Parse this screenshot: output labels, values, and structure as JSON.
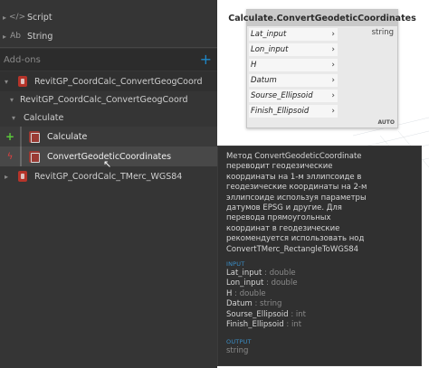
{
  "library": {
    "items": [
      {
        "label": "Script",
        "icon": "script-icon",
        "glyph": "</>"
      },
      {
        "label": "String",
        "icon": "string-icon",
        "glyph": "Ab"
      }
    ],
    "addons_label": "Add-ons",
    "add_button": "+",
    "tree": {
      "package": "RevitGP_CoordCalc_ConvertGeogCoord",
      "sub_package": "RevitGP_CoordCalc_ConvertGeogCoord",
      "category": "Calculate",
      "create_node": "Calculate",
      "action_node": "ConvertGeodeticCoordinates",
      "other_package": "RevitGP_CoordCalc_TMerc_WGS84"
    }
  },
  "node": {
    "title": "Calculate.ConvertGeodeticCoordinates",
    "inputs": [
      "Lat_input",
      "Lon_input",
      "H",
      "Datum",
      "Sourse_Ellipsoid",
      "Finish_Ellipsoid"
    ],
    "output": "string",
    "lacing": "AUTO"
  },
  "tooltip": {
    "description": "Метод ConvertGeodeticCoordinate\nпереводит геодезические\nкоординаты на 1-м эллипсоиде в\nгеодезические координаты на 2-м\nэллипсоиде используя параметры\nдатумов EPSG и другие. Для\nперевода прямоугольных\nкоординат в геодезические\nрекомендуется использовать нод\nConvertTMerc_RectangleToWGS84",
    "input_header": "INPUT",
    "params": [
      {
        "name": "Lat_input",
        "type": "double"
      },
      {
        "name": "Lon_input",
        "type": "double"
      },
      {
        "name": "H",
        "type": "double"
      },
      {
        "name": "Datum",
        "type": "string"
      },
      {
        "name": "Sourse_Ellipsoid",
        "type": "int"
      },
      {
        "name": "Finish_Ellipsoid",
        "type": "int"
      }
    ],
    "type_separator": " : ",
    "output_header": "OUTPUT",
    "output_type": "string"
  },
  "colors": {
    "accent": "#3a8fc9",
    "add_green": "#5ac83a",
    "action_red": "#e04040",
    "revit_red": "#b5342a"
  }
}
